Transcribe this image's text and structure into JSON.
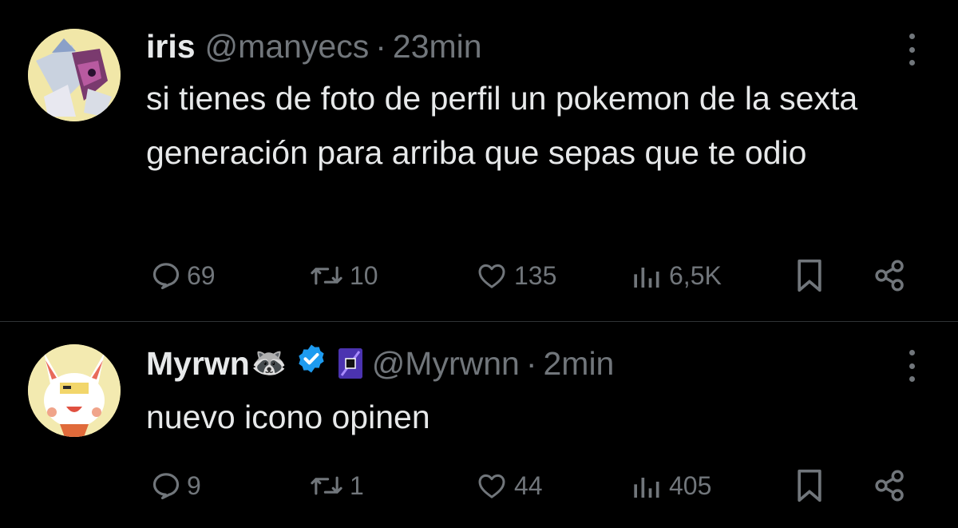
{
  "tweets": [
    {
      "display_name": "iris",
      "handle": "@manyecs",
      "separator": "·",
      "time": "23min",
      "text": "si tienes de foto de perfil un pokemon de la sexta generación para arriba que sepas que te odio",
      "avatar_icon": "pokemon-avatar-icon",
      "stats": {
        "replies": "69",
        "reposts": "10",
        "likes": "135",
        "views": "6,5K"
      }
    },
    {
      "display_name": "Myrwn",
      "name_emoji": "🦝",
      "verified": true,
      "affiliate_badge_icon": "affiliate-badge-icon",
      "handle": "@Myrwnn",
      "separator": "·",
      "time": "2min",
      "text": "nuevo icono opinen",
      "avatar_icon": "pokemon-avatar-icon",
      "stats": {
        "replies": "9",
        "reposts": "1",
        "likes": "44",
        "views": "405"
      }
    }
  ],
  "colors": {
    "background": "#000000",
    "text_primary": "#e7e9ea",
    "text_secondary": "#71767b",
    "divider": "#2f3336",
    "verified_blue": "#1d9bf0"
  }
}
